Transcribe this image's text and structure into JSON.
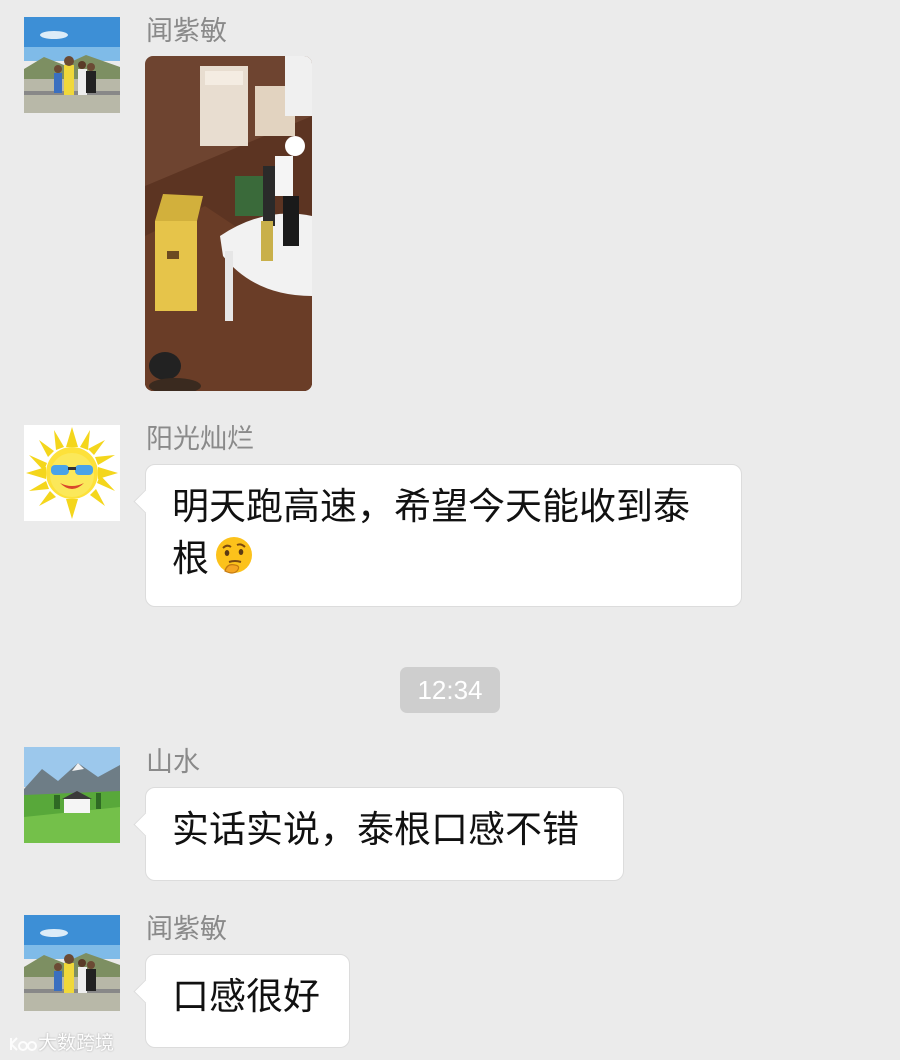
{
  "chat": {
    "messages": [
      {
        "sender": "闻紫敏",
        "type": "image",
        "avatar_icon": "family-landscape-avatar-icon"
      },
      {
        "sender": "阳光灿烂",
        "type": "text",
        "line1": "明天跑高速，希望今天能收到泰",
        "line2": "根",
        "emoji": "thinking-face-emoji",
        "avatar_icon": "smiling-sun-avatar-icon"
      },
      {
        "sender": "山水",
        "type": "text",
        "text": "实话实说，泰根口感不错",
        "avatar_icon": "mountain-meadow-avatar-icon"
      },
      {
        "sender": "闻紫敏",
        "type": "text",
        "text": "口感很好",
        "avatar_icon": "family-landscape-avatar-icon"
      }
    ],
    "timestamp": "12:34"
  },
  "watermark": {
    "text": "大数跨境"
  },
  "colors": {
    "background": "#ebebeb",
    "bubble": "#ffffff",
    "name_text": "#8a8a8a",
    "time_pill": "#cecece"
  }
}
